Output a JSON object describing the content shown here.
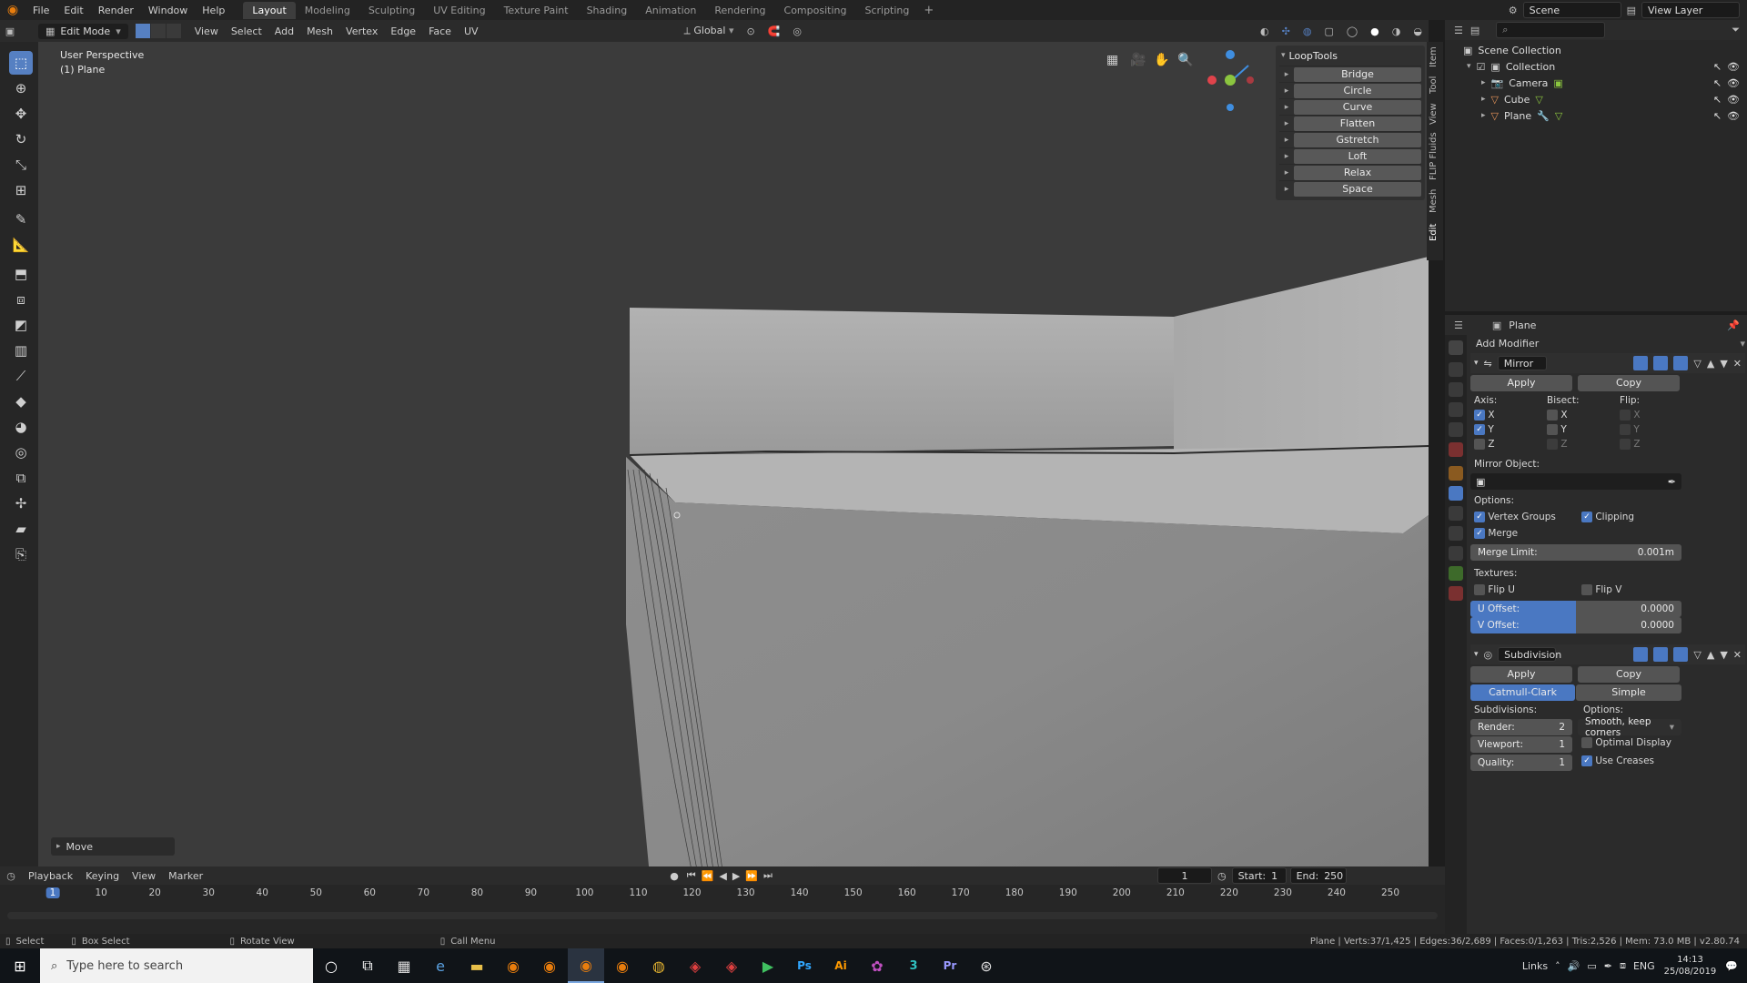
{
  "topbar": {
    "menus": [
      "File",
      "Edit",
      "Render",
      "Window",
      "Help"
    ],
    "workspaces": [
      "Layout",
      "Modeling",
      "Sculpting",
      "UV Editing",
      "Texture Paint",
      "Shading",
      "Animation",
      "Rendering",
      "Compositing",
      "Scripting"
    ],
    "active_workspace": "Layout",
    "add_tab": "+",
    "scene_label": "Scene",
    "view_layer_label": "View Layer"
  },
  "viewport_header": {
    "mode": "Edit Mode",
    "menus": [
      "View",
      "Select",
      "Add",
      "Mesh",
      "Vertex",
      "Edge",
      "Face",
      "UV"
    ],
    "orientation": "Global"
  },
  "viewport": {
    "perspective_label": "User Perspective",
    "object_label": "(1) Plane",
    "last_op": "Move",
    "axis_colors": {
      "x": "#e0434b",
      "y": "#8bc53f",
      "z": "#3f8ee0"
    }
  },
  "looptools": {
    "title": "LoopTools",
    "items": [
      "Bridge",
      "Circle",
      "Curve",
      "Flatten",
      "Gstretch",
      "Loft",
      "Relax",
      "Space"
    ]
  },
  "sidebar_tabs": [
    "Item",
    "Tool",
    "View",
    "FLIP Fluids",
    "Mesh",
    "Edit"
  ],
  "outliner": {
    "root": "Scene Collection",
    "collection": "Collection",
    "objects": [
      "Camera",
      "Cube",
      "Plane"
    ]
  },
  "properties": {
    "object_name": "Plane",
    "add_modifier": "Add Modifier",
    "mirror": {
      "name": "Mirror",
      "apply": "Apply",
      "copy": "Copy",
      "axis_label": "Axis:",
      "bisect_label": "Bisect:",
      "flip_label": "Flip:",
      "axes": [
        "X",
        "Y",
        "Z"
      ],
      "mirror_object_label": "Mirror Object:",
      "options_label": "Options:",
      "vertex_groups": "Vertex Groups",
      "clipping": "Clipping",
      "merge": "Merge",
      "merge_limit_label": "Merge Limit:",
      "merge_limit_value": "0.001m",
      "textures_label": "Textures:",
      "flip_u": "Flip U",
      "flip_v": "Flip V",
      "u_offset_label": "U Offset:",
      "u_offset_value": "0.0000",
      "v_offset_label": "V Offset:",
      "v_offset_value": "0.0000"
    },
    "subdivision": {
      "name": "Subdivision",
      "apply": "Apply",
      "copy": "Copy",
      "catmull": "Catmull-Clark",
      "simple": "Simple",
      "subdivisions_label": "Subdivisions:",
      "options_label": "Options:",
      "render_label": "Render:",
      "render_value": "2",
      "viewport_label": "Viewport:",
      "viewport_value": "1",
      "quality_label": "Quality:",
      "quality_value": "1",
      "uv_smooth": "Smooth, keep corners",
      "optimal_display": "Optimal Display",
      "use_creases": "Use Creases"
    }
  },
  "timeline": {
    "menus": [
      "Playback",
      "Keying",
      "View",
      "Marker"
    ],
    "current_frame": "1",
    "start_label": "Start:",
    "start_value": "1",
    "end_label": "End:",
    "end_value": "250",
    "ticks": [
      "1",
      "10",
      "20",
      "30",
      "40",
      "50",
      "60",
      "70",
      "80",
      "90",
      "100",
      "110",
      "120",
      "130",
      "140",
      "150",
      "160",
      "170",
      "180",
      "190",
      "200",
      "210",
      "220",
      "230",
      "240",
      "250"
    ]
  },
  "statusbar": {
    "select": "Select",
    "box_select": "Box Select",
    "rotate_view": "Rotate View",
    "call_menu": "Call Menu",
    "stats": "Plane | Verts:37/1,425 | Edges:36/2,689 | Faces:0/1,263 | Tris:2,526 | Mem: 73.0 MB | v2.80.74"
  },
  "taskbar": {
    "search_placeholder": "Type here to search",
    "links": "Links",
    "lang": "ENG",
    "time": "14:13",
    "date": "25/08/2019"
  }
}
